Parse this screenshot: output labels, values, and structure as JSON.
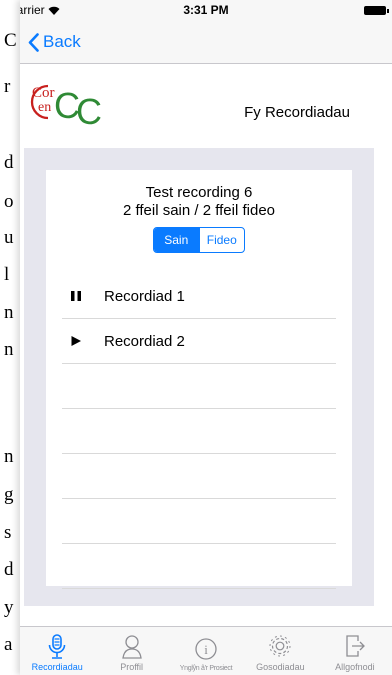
{
  "background_letters": [
    "C",
    "r",
    "d",
    "o",
    "u",
    "l",
    "n",
    "n",
    "n",
    "g",
    "s",
    "d",
    "y",
    "a"
  ],
  "status_bar": {
    "carrier": "Carrier",
    "time": "3:31 PM"
  },
  "nav": {
    "back_label": "Back"
  },
  "header": {
    "logo_text": [
      "Cor",
      "en",
      "C",
      "C"
    ],
    "title": "Fy Recordiadau"
  },
  "recording": {
    "title": "Test recording 6",
    "subtitle": "2 ffeil sain / 2 ffeil fideo"
  },
  "segmented": {
    "options": [
      "Sain",
      "Fideo"
    ],
    "selected": "Sain"
  },
  "rows": [
    {
      "label": "Recordiad 1",
      "state": "pause-icon"
    },
    {
      "label": "Recordiad 2",
      "state": "play-icon"
    }
  ],
  "tabs": [
    {
      "label": "Recordiadau",
      "icon": "microphone-icon",
      "active": true
    },
    {
      "label": "Proffil",
      "icon": "person-icon",
      "active": false
    },
    {
      "label": "Ynglŷn â'r Prosiect",
      "icon": "info-icon",
      "active": false
    },
    {
      "label": "Gosodiadau",
      "icon": "gear-icon",
      "active": false
    },
    {
      "label": "Allgofnodi",
      "icon": "logout-icon",
      "active": false
    }
  ],
  "colors": {
    "accent": "#0a7bff",
    "panel": "#e6e6ee",
    "logo_red": "#c8201e",
    "logo_green": "#2f8a35"
  }
}
